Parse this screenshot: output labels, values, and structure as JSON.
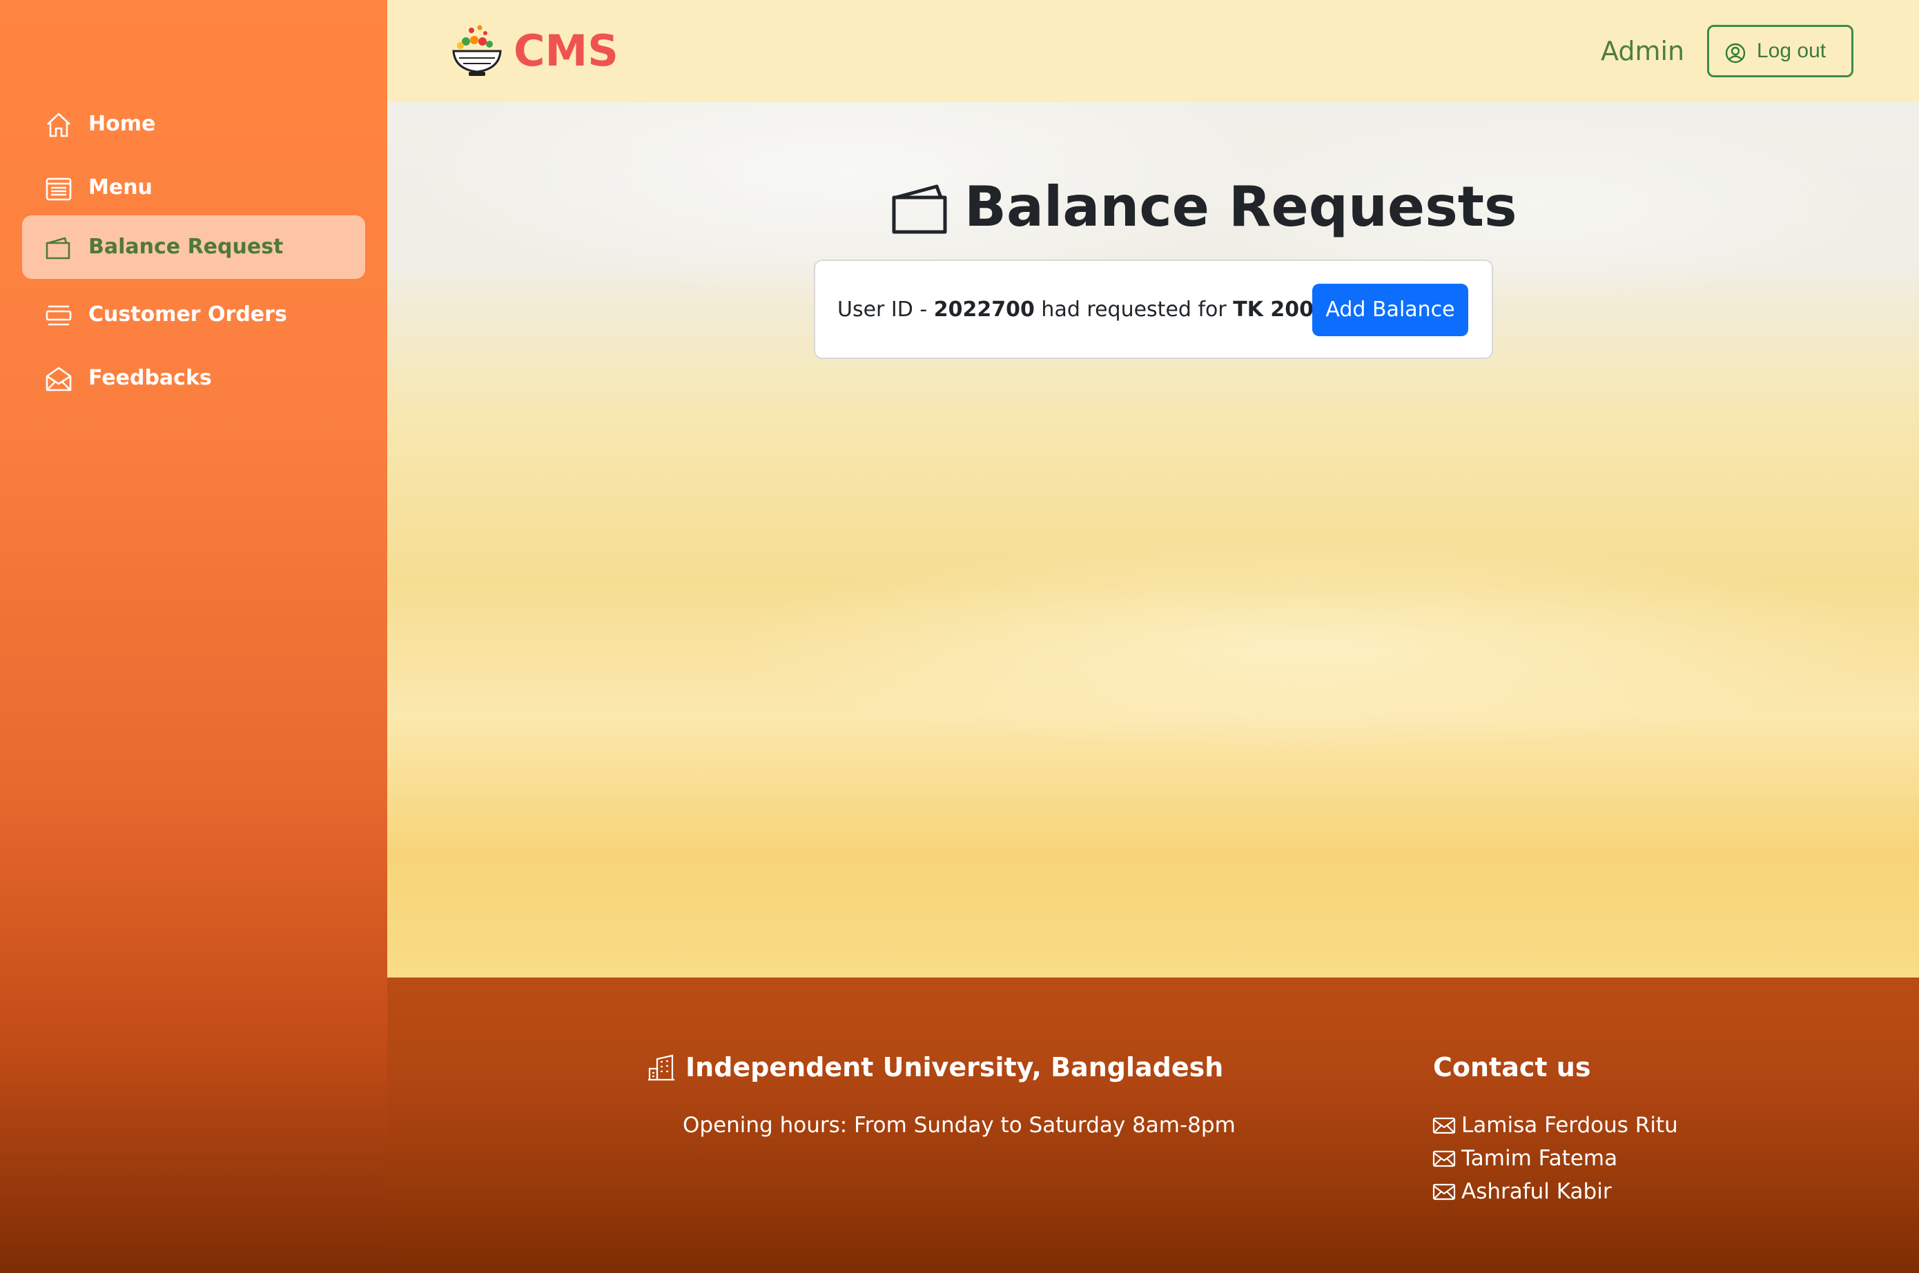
{
  "header": {
    "brand": "CMS",
    "user_role": "Admin",
    "logout_label": "Log out"
  },
  "sidebar": {
    "items": [
      {
        "label": "Home",
        "icon": "home-icon",
        "active": false
      },
      {
        "label": "Menu",
        "icon": "menu-list-icon",
        "active": false
      },
      {
        "label": "Balance Request",
        "icon": "wallet-icon",
        "active": true
      },
      {
        "label": "Customer Orders",
        "icon": "orders-icon",
        "active": false
      },
      {
        "label": "Feedbacks",
        "icon": "envelope-open-icon",
        "active": false
      }
    ]
  },
  "main": {
    "title": "Balance Requests",
    "requests": [
      {
        "prefix": "User ID - ",
        "user_id": "2022700",
        "middle": " had requested for ",
        "amount": "TK 200",
        "suffix": ".",
        "button_label": "Add Balance"
      }
    ]
  },
  "footer": {
    "university": "Independent University, Bangladesh",
    "hours": "Opening hours: From Sunday to Saturday 8am-8pm",
    "contact_title": "Contact us",
    "contacts": [
      "Lamisa Ferdous Ritu",
      "Tamim Fatema",
      "Ashraful Kabir"
    ]
  },
  "colors": {
    "sidebar_accent": "#ff8540",
    "active_item_bg": "#fdc5a6",
    "active_item_text": "#4f7a34",
    "brand": "#ef5350",
    "primary_button": "#0d6efd",
    "header_bg": "#fcedbf",
    "footer_bg": "#b04612"
  }
}
